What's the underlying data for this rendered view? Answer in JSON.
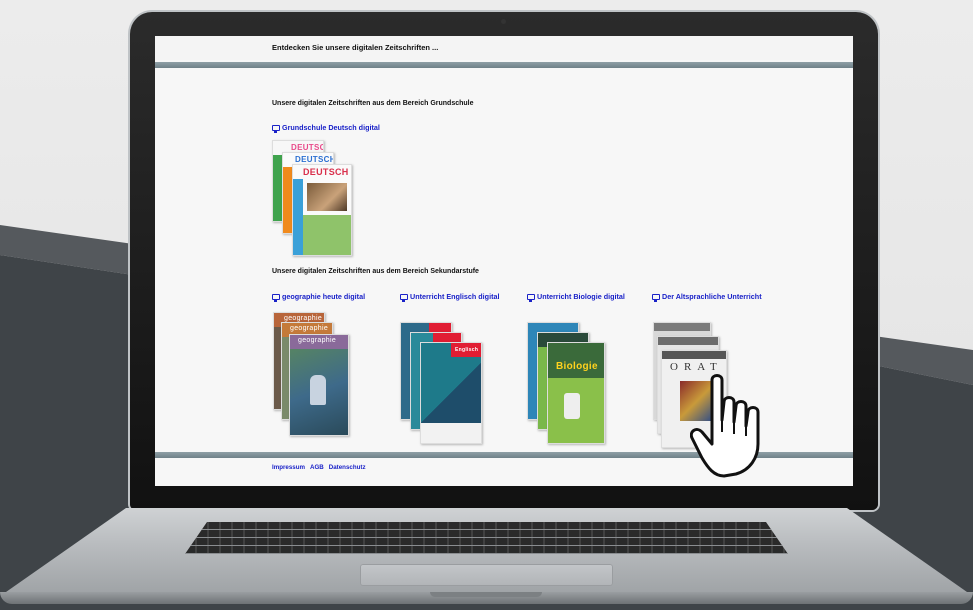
{
  "page": {
    "site_title": "Entdecken Sie unsere digitalen Zeitschriften ...",
    "section_grundschule": "Unsere digitalen Zeitschriften aus dem Bereich Grundschule",
    "section_sekundarstufe": "Unsere digitalen Zeitschriften aus dem Bereich Sekundarstufe"
  },
  "magazines": {
    "grundschule_deutsch": {
      "label": "Grundschule Deutsch digital",
      "cover_word": "DEUTSCH"
    },
    "geographie": {
      "label": "geographie heute digital",
      "cover_word": "geographie"
    },
    "englisch": {
      "label": "Unterricht Englisch digital",
      "cover_word": "Englisch"
    },
    "biologie": {
      "label": "Unterricht Biologie digital",
      "cover_word": "Biologie"
    },
    "altsprachlich": {
      "label": "Der Altsprachliche Unterricht",
      "cover_word": "ORAT"
    }
  },
  "footer": {
    "impressum": "Impressum",
    "agb": "AGB",
    "datenschutz": "Datenschutz"
  },
  "icons": {
    "link_icon": "monitor-icon",
    "cursor": "hand-pointer-icon"
  },
  "colors": {
    "link": "#1a22c8",
    "rule": "#7a8c92",
    "background_dark": "#3f4448"
  }
}
